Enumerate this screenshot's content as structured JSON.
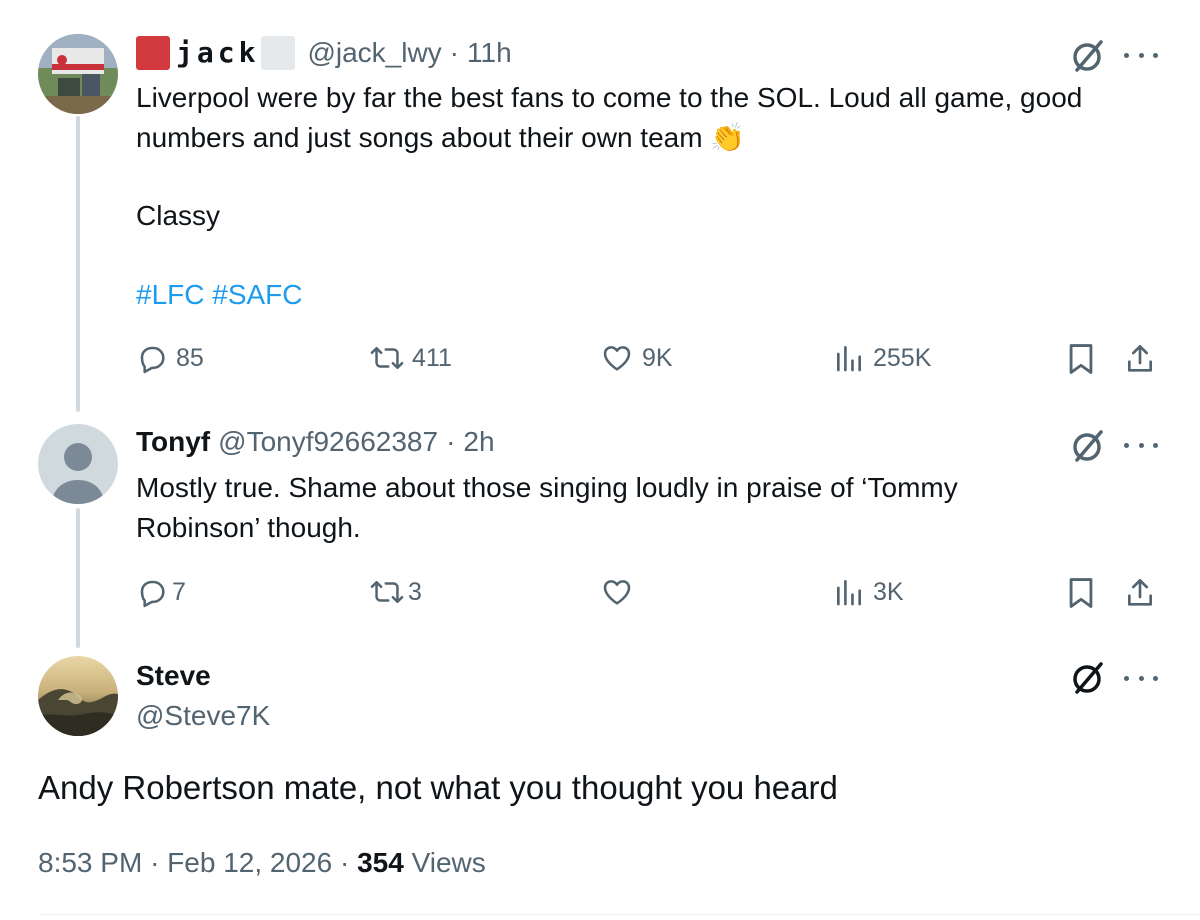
{
  "tweets": [
    {
      "display_name": "jack",
      "handle": "@jack_lwy",
      "time": "11h",
      "text": "Liverpool were by far the best fans to come to the SOL. Loud all game, good numbers and just songs about their own team",
      "emoji": "👏",
      "text2": "Classy",
      "hashtags": "#LFC #SAFC",
      "replies": "85",
      "reposts": "411",
      "likes": "9K",
      "views": "255K",
      "flag_colors": [
        "#d23a3f",
        "#e6e9ec"
      ]
    },
    {
      "display_name": "Tonyf",
      "handle": "@Tonyf92662387",
      "time": "2h",
      "text": "Mostly true. Shame about those singing loudly in praise of ‘Tommy Robinson’ though.",
      "replies": "7",
      "reposts": "3",
      "likes": "",
      "views": "3K"
    }
  ],
  "main": {
    "display_name": "Steve",
    "handle": "@Steve7K",
    "text": "Andy Robertson mate, not what you thought you heard",
    "time": "8:53 PM",
    "date": "Feb 12, 2026",
    "views_count": "354",
    "views_label": "Views"
  },
  "icons": {
    "reply": "reply-icon",
    "repost": "repost-icon",
    "like": "heart-icon",
    "views": "views-icon",
    "bookmark": "bookmark-icon",
    "share": "share-icon",
    "grok": "grok-icon",
    "more": "more-icon"
  },
  "colors": {
    "link": "#1d9bf0",
    "muted": "#536471",
    "text": "#0f1419",
    "thread": "#cfd9de"
  }
}
